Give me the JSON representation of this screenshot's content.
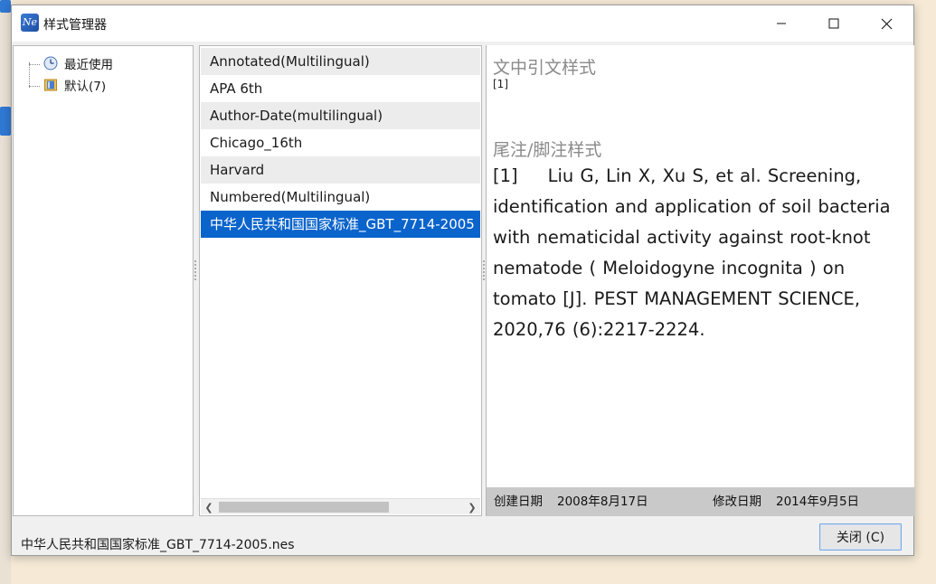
{
  "window": {
    "title": "样式管理器",
    "app_icon_text": "Ne"
  },
  "tree": {
    "items": [
      {
        "label": "最近使用",
        "icon": "clock-icon"
      },
      {
        "label": "默认(7)",
        "icon": "folder-book-icon"
      }
    ]
  },
  "style_list": {
    "items": [
      "Annotated(Multilingual)",
      "APA 6th",
      "Author-Date(multilingual)",
      "Chicago_16th",
      "Harvard",
      "Numbered(Multilingual)",
      "中华人民共和国国家标准_GBT_7714-2005"
    ],
    "selected_index": 6
  },
  "preview": {
    "intext_heading": "文中引文样式",
    "intext_sample": "[1]",
    "footnote_heading": "尾注/脚注样式",
    "footnote_number": "[1]",
    "footnote_text": "Liu G, Lin X, Xu S, et al. Screening, identification and application of soil bacteria with nematicidal activity against root-knot nematode ( Meloidogyne incognita ) on tomato [J]. PEST MANAGEMENT SCIENCE, 2020,76 (6):2217-2224.",
    "created_label": "创建日期",
    "created_value": "2008年8月17日",
    "modified_label": "修改日期",
    "modified_value": "2014年9月5日"
  },
  "status": {
    "filename": "中华人民共和国国家标准_GBT_7714-2005.nes"
  },
  "buttons": {
    "close_label": "关闭 (C)"
  },
  "colors": {
    "selection": "#0a64cc",
    "alt_row": "#ececec",
    "preview_footer": "#c9c9c9"
  }
}
